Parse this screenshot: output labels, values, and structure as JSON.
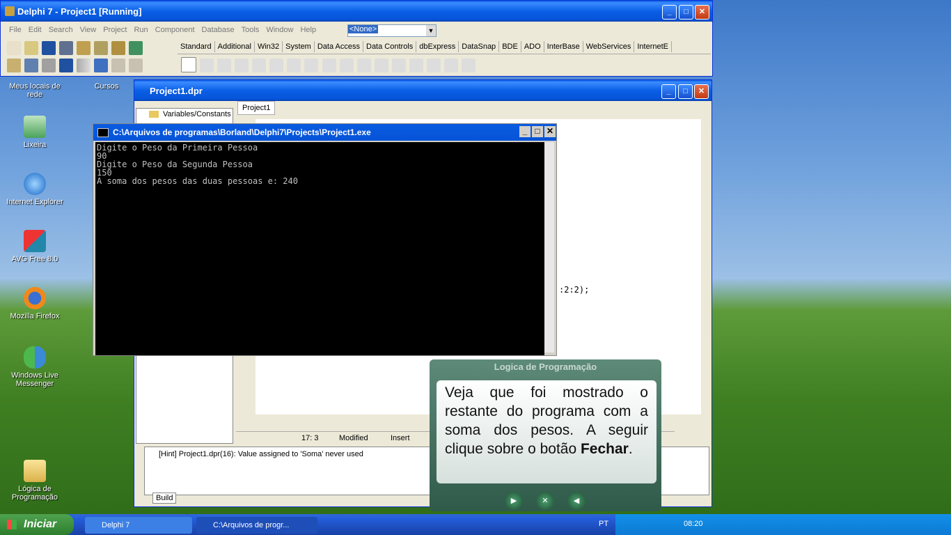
{
  "desktop": {
    "icons": [
      {
        "label": "Meus locais de rede"
      },
      {
        "label": "Cursos"
      },
      {
        "label": "Lixeira"
      },
      {
        "label": "Internet Explorer"
      },
      {
        "label": "AVG Free 8.0"
      },
      {
        "label": "Mozilla Firefox"
      },
      {
        "label": "Windows Live Messenger"
      },
      {
        "label": "Lógica de Programação"
      }
    ]
  },
  "delphi": {
    "title": "Delphi 7 - Project1 [Running]",
    "menu": [
      "File",
      "Edit",
      "Search",
      "View",
      "Project",
      "Run",
      "Component",
      "Database",
      "Tools",
      "Window",
      "Help"
    ],
    "combo_value": "<None>",
    "palette_tabs": [
      "Standard",
      "Additional",
      "Win32",
      "System",
      "Data Access",
      "Data Controls",
      "dbExpress",
      "DataSnap",
      "BDE",
      "ADO",
      "InterBase",
      "WebServices",
      "InternetE"
    ]
  },
  "editor": {
    "title": "Project1.dpr",
    "tree_item": "Variables/Constants",
    "tab": "Project1",
    "code_fragment": ":2:2);",
    "status": {
      "position": "17:   3",
      "modified": "Modified",
      "mode": "Insert"
    },
    "message": "[Hint] Project1.dpr(16): Value assigned to 'Soma' never used",
    "bottom_tab": "Build"
  },
  "console": {
    "title": "C:\\Arquivos de programas\\Borland\\Delphi7\\Projects\\Project1.exe",
    "lines": [
      "Digite o Peso da Primeira Pessoa",
      "90",
      "Digite o Peso da Segunda Pessoa",
      "150",
      "A soma dos pesos das duas pessoas e: 240"
    ]
  },
  "tutorial": {
    "header": "Logica de Programação",
    "text_before": "Veja que foi mostrado o restante do programa com a soma dos pesos. A seguir clique sobre o botão ",
    "text_bold": "Fechar",
    "text_after": "."
  },
  "taskbar": {
    "start_label": "Iniciar",
    "tasks": [
      "Delphi 7",
      "C:\\Arquivos de progr..."
    ],
    "language": "PT",
    "clock": "08:20"
  }
}
